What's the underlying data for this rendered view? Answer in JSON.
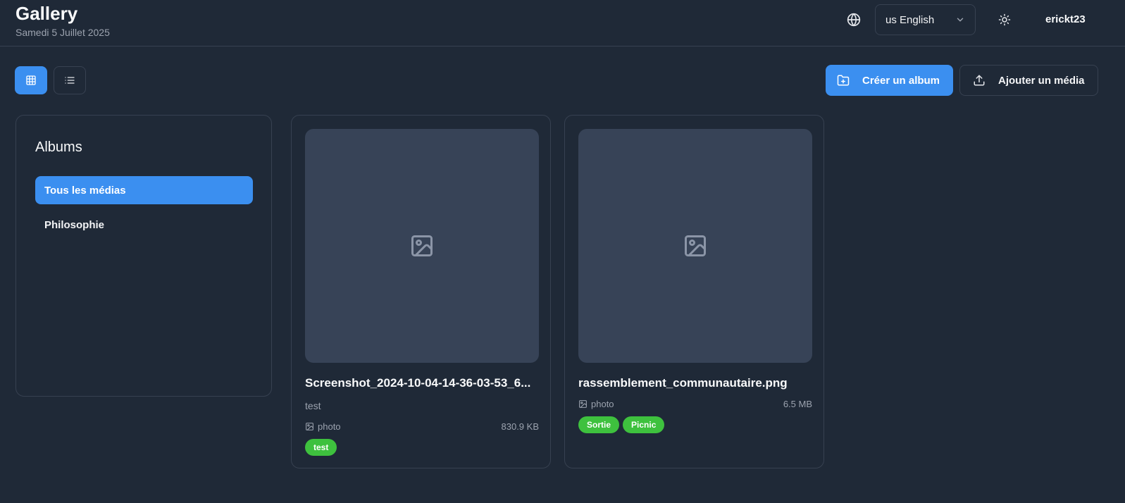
{
  "header": {
    "title": "Gallery",
    "date": "Samedi 5 Juillet 2025",
    "language": "us English",
    "username": "erickt23"
  },
  "toolbar": {
    "create_album_label": "Créer un album",
    "add_media_label": "Ajouter un média"
  },
  "albums": {
    "title": "Albums",
    "items": [
      {
        "label": "Tous les médias",
        "active": true
      },
      {
        "label": "Philosophie",
        "active": false
      }
    ]
  },
  "media": [
    {
      "name": "Screenshot_2024-10-04-14-36-03-53_6...",
      "description": "test",
      "type": "photo",
      "size": "830.9 KB",
      "tags": [
        "test"
      ]
    },
    {
      "name": "rassemblement_communautaire.png",
      "description": "",
      "type": "photo",
      "size": "6.5 MB",
      "tags": [
        "Sortie",
        "Picnic"
      ]
    }
  ],
  "colors": {
    "background": "#1f2937",
    "accent": "#3b8ff0",
    "tag": "#3ec13e",
    "border": "#374151",
    "thumbnail": "#374357"
  },
  "icons": {
    "language": "globe-icon",
    "theme": "sun-icon",
    "grid_view": "grid-icon",
    "list_view": "list-icon",
    "create_album": "folder-plus-icon",
    "add_media": "upload-icon",
    "placeholder": "image-icon"
  }
}
